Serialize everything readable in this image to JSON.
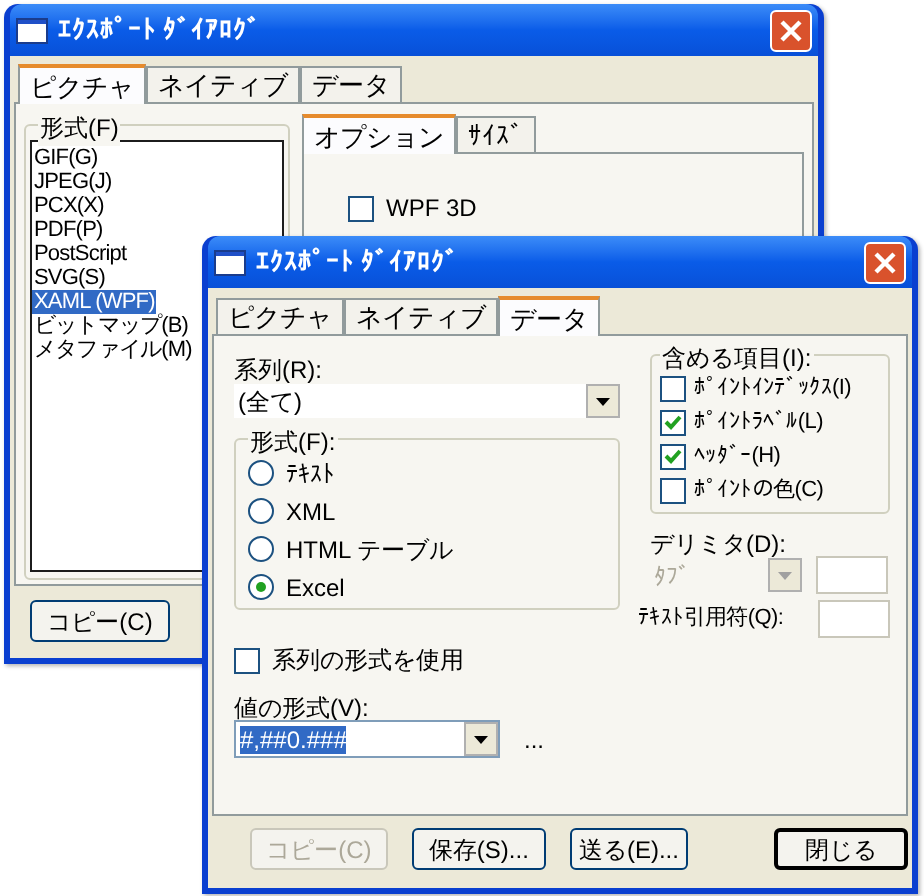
{
  "windows": [
    {
      "title": "ｴｸｽﾎﾟｰﾄ ﾀﾞｲｱﾛｸﾞ",
      "tabs": [
        {
          "label": "ピクチャ",
          "selected": true
        },
        {
          "label": "ネイティブ",
          "selected": false
        },
        {
          "label": "データ",
          "selected": false
        }
      ],
      "format_group": {
        "label": "形式(F)",
        "items": [
          {
            "label": "GIF(G)",
            "selected": false
          },
          {
            "label": "JPEG(J)",
            "selected": false
          },
          {
            "label": "PCX(X)",
            "selected": false
          },
          {
            "label": "PDF(P)",
            "selected": false
          },
          {
            "label": "PostScript",
            "selected": false
          },
          {
            "label": "SVG(S)",
            "selected": false
          },
          {
            "label": "XAML (WPF)",
            "selected": true
          },
          {
            "label": "ビットマップ(B)",
            "selected": false
          },
          {
            "label": "メタファイル(M)",
            "selected": false
          }
        ]
      },
      "option_tabs": [
        {
          "label": "オプション",
          "selected": true
        },
        {
          "label": "ｻｲｽﾞ",
          "selected": false
        }
      ],
      "options": [
        {
          "label": "WPF 3D",
          "checked": false
        }
      ],
      "buttons": [
        {
          "label": "コピー(C)",
          "disabled": false,
          "default": false
        }
      ]
    },
    {
      "title": "ｴｸｽﾎﾟｰﾄ ﾀﾞｲｱﾛｸﾞ",
      "tabs": [
        {
          "label": "ピクチャ",
          "selected": false
        },
        {
          "label": "ネイティブ",
          "selected": false
        },
        {
          "label": "データ",
          "selected": true
        }
      ],
      "series": {
        "label": "系列(R):",
        "value": "(全て)"
      },
      "format_group": {
        "label": "形式(F):",
        "options": [
          {
            "label": "ﾃｷｽﾄ",
            "selected": false
          },
          {
            "label": "XML",
            "selected": false
          },
          {
            "label": "HTML テーブル",
            "selected": false
          },
          {
            "label": "Excel",
            "selected": true
          }
        ]
      },
      "include_group": {
        "label": "含める項目(I):",
        "items": [
          {
            "label": "ﾎﾟｲﾝﾄｲﾝﾃﾞｯｸｽ(I)",
            "checked": false
          },
          {
            "label": "ﾎﾟｲﾝﾄﾗﾍﾞﾙ(L)",
            "checked": true
          },
          {
            "label": "ﾍｯﾀﾞｰ(H)",
            "checked": true
          },
          {
            "label": "ﾎﾟｲﾝﾄの色(C)",
            "checked": false
          }
        ]
      },
      "delimiter": {
        "label": "デリミタ(D):",
        "value": "ﾀﾌﾞ",
        "disabled": true
      },
      "quote": {
        "label": "ﾃｷｽﾄ引用符(Q):"
      },
      "use_series_format": {
        "label": "系列の形式を使用",
        "checked": false
      },
      "value_format": {
        "label": "値の形式(V):",
        "value": "#,##0.###",
        "highlighted": true,
        "more": "..."
      },
      "buttons": [
        {
          "label": "コピー(C)",
          "disabled": true,
          "default": false
        },
        {
          "label": "保存(S)...",
          "disabled": false,
          "default": false
        },
        {
          "label": "送る(E)...",
          "disabled": false,
          "default": false
        },
        {
          "label": "閉じる",
          "disabled": false,
          "default": true
        }
      ]
    }
  ]
}
